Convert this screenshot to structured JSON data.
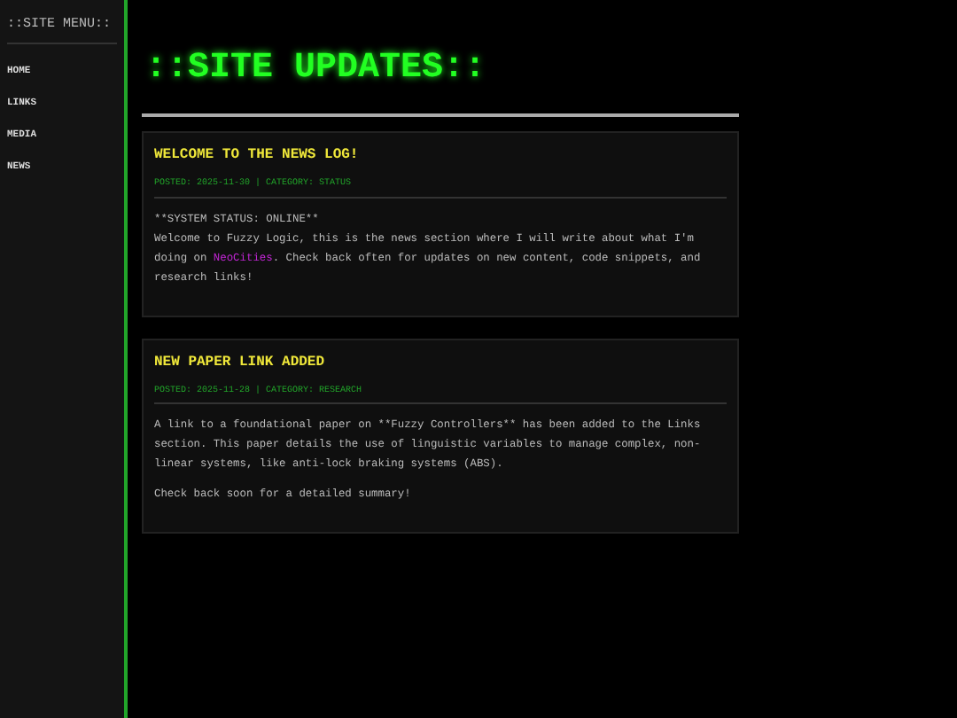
{
  "sidebar": {
    "title": "::SITE MENU::",
    "items": [
      {
        "label": "HOME"
      },
      {
        "label": "LINKS"
      },
      {
        "label": "MEDIA"
      },
      {
        "label": "NEWS"
      }
    ]
  },
  "page_title": "::SITE UPDATES::",
  "posts": [
    {
      "title": "WELCOME TO THE NEWS LOG!",
      "meta": "POSTED: 2025-11-30 | CATEGORY: STATUS",
      "paragraphs": [
        [
          [
            {
              "kind": "text",
              "text": "**SYSTEM STATUS: ONLINE**"
            }
          ],
          [
            {
              "kind": "text",
              "text": "Welcome to Fuzzy Logic, this is the news section where I will write about what I'm doing on "
            },
            {
              "kind": "link",
              "text": "NeoCities"
            },
            {
              "kind": "text",
              "text": ". Check back often for updates on new content, code snippets, and research links!"
            }
          ]
        ]
      ]
    },
    {
      "title": "NEW PAPER LINK ADDED",
      "meta": "POSTED: 2025-11-28 | CATEGORY: RESEARCH",
      "paragraphs": [
        [
          [
            {
              "kind": "text",
              "text": "A link to a foundational paper on **Fuzzy Controllers** has been added to the Links section. This paper details the use of linguistic variables to manage complex, non-linear systems, like anti-lock braking systems (ABS)."
            }
          ]
        ],
        [
          [
            {
              "kind": "text",
              "text": "Check back soon for a detailed summary!"
            }
          ]
        ]
      ]
    }
  ]
}
